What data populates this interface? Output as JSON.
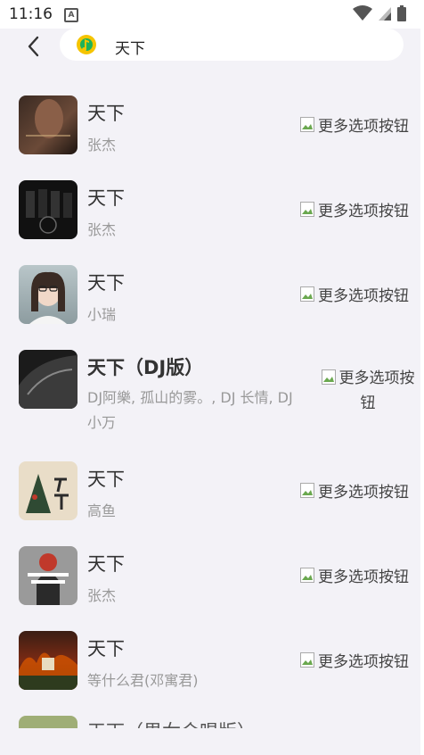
{
  "status": {
    "time": "11:16"
  },
  "search": {
    "query": "天下"
  },
  "more_label": "更多选项按钮",
  "songs": [
    {
      "title": "天下",
      "artist": "张杰"
    },
    {
      "title": "天下",
      "artist": "张杰"
    },
    {
      "title": "天下",
      "artist": "小瑞"
    },
    {
      "title": "天下（DJ版）",
      "artist": "DJ阿樂, 孤山的雾。, DJ 长情, DJ小万"
    },
    {
      "title": "天下",
      "artist": "高鱼"
    },
    {
      "title": "天下",
      "artist": "张杰"
    },
    {
      "title": "天下",
      "artist": "等什么君(邓寓君)"
    },
    {
      "title": "天下（男女合唱版）",
      "artist": ""
    }
  ],
  "colors": {
    "background": "#f3f2f7",
    "title_text": "#333333",
    "artist_text": "#999999",
    "logo_yellow": "#f5c400",
    "logo_green": "#1fb25a"
  }
}
